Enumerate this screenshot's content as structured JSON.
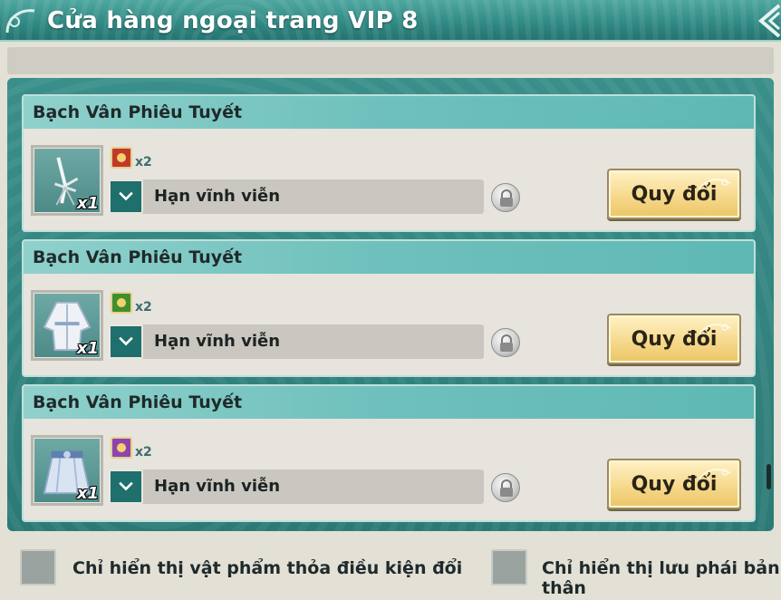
{
  "window": {
    "title": "Cửa hàng ngoại trang VIP 8"
  },
  "items": [
    {
      "name": "Bạch Vân Phiêu Tuyết",
      "quantity": "x1",
      "cost_quantity": "x2",
      "cost_color": "#c0392b",
      "duration": "Hạn vĩnh viễn",
      "exchange_label": "Quy đổi",
      "icon": "sword-icon"
    },
    {
      "name": "Bạch Vân Phiêu Tuyết",
      "quantity": "x1",
      "cost_quantity": "x2",
      "cost_color": "#3f8f2f",
      "duration": "Hạn vĩnh viễn",
      "exchange_label": "Quy đổi",
      "icon": "robe-icon"
    },
    {
      "name": "Bạch Vân Phiêu Tuyết",
      "quantity": "x1",
      "cost_quantity": "x2",
      "cost_color": "#8e44ad",
      "duration": "Hạn vĩnh viễn",
      "exchange_label": "Quy đổi",
      "icon": "skirt-icon"
    }
  ],
  "footer": {
    "filter_eligible_label": "Chỉ hiển thị vật phẩm thỏa điều kiện đổi",
    "filter_own_sect_label": "Chỉ hiển thị lưu phái bản thân"
  },
  "colors": {
    "title_bar": "#2f8883",
    "list_frame": "#2c7a76",
    "item_header": "#6ec0bc",
    "exchange_button": "#f6d98d"
  }
}
